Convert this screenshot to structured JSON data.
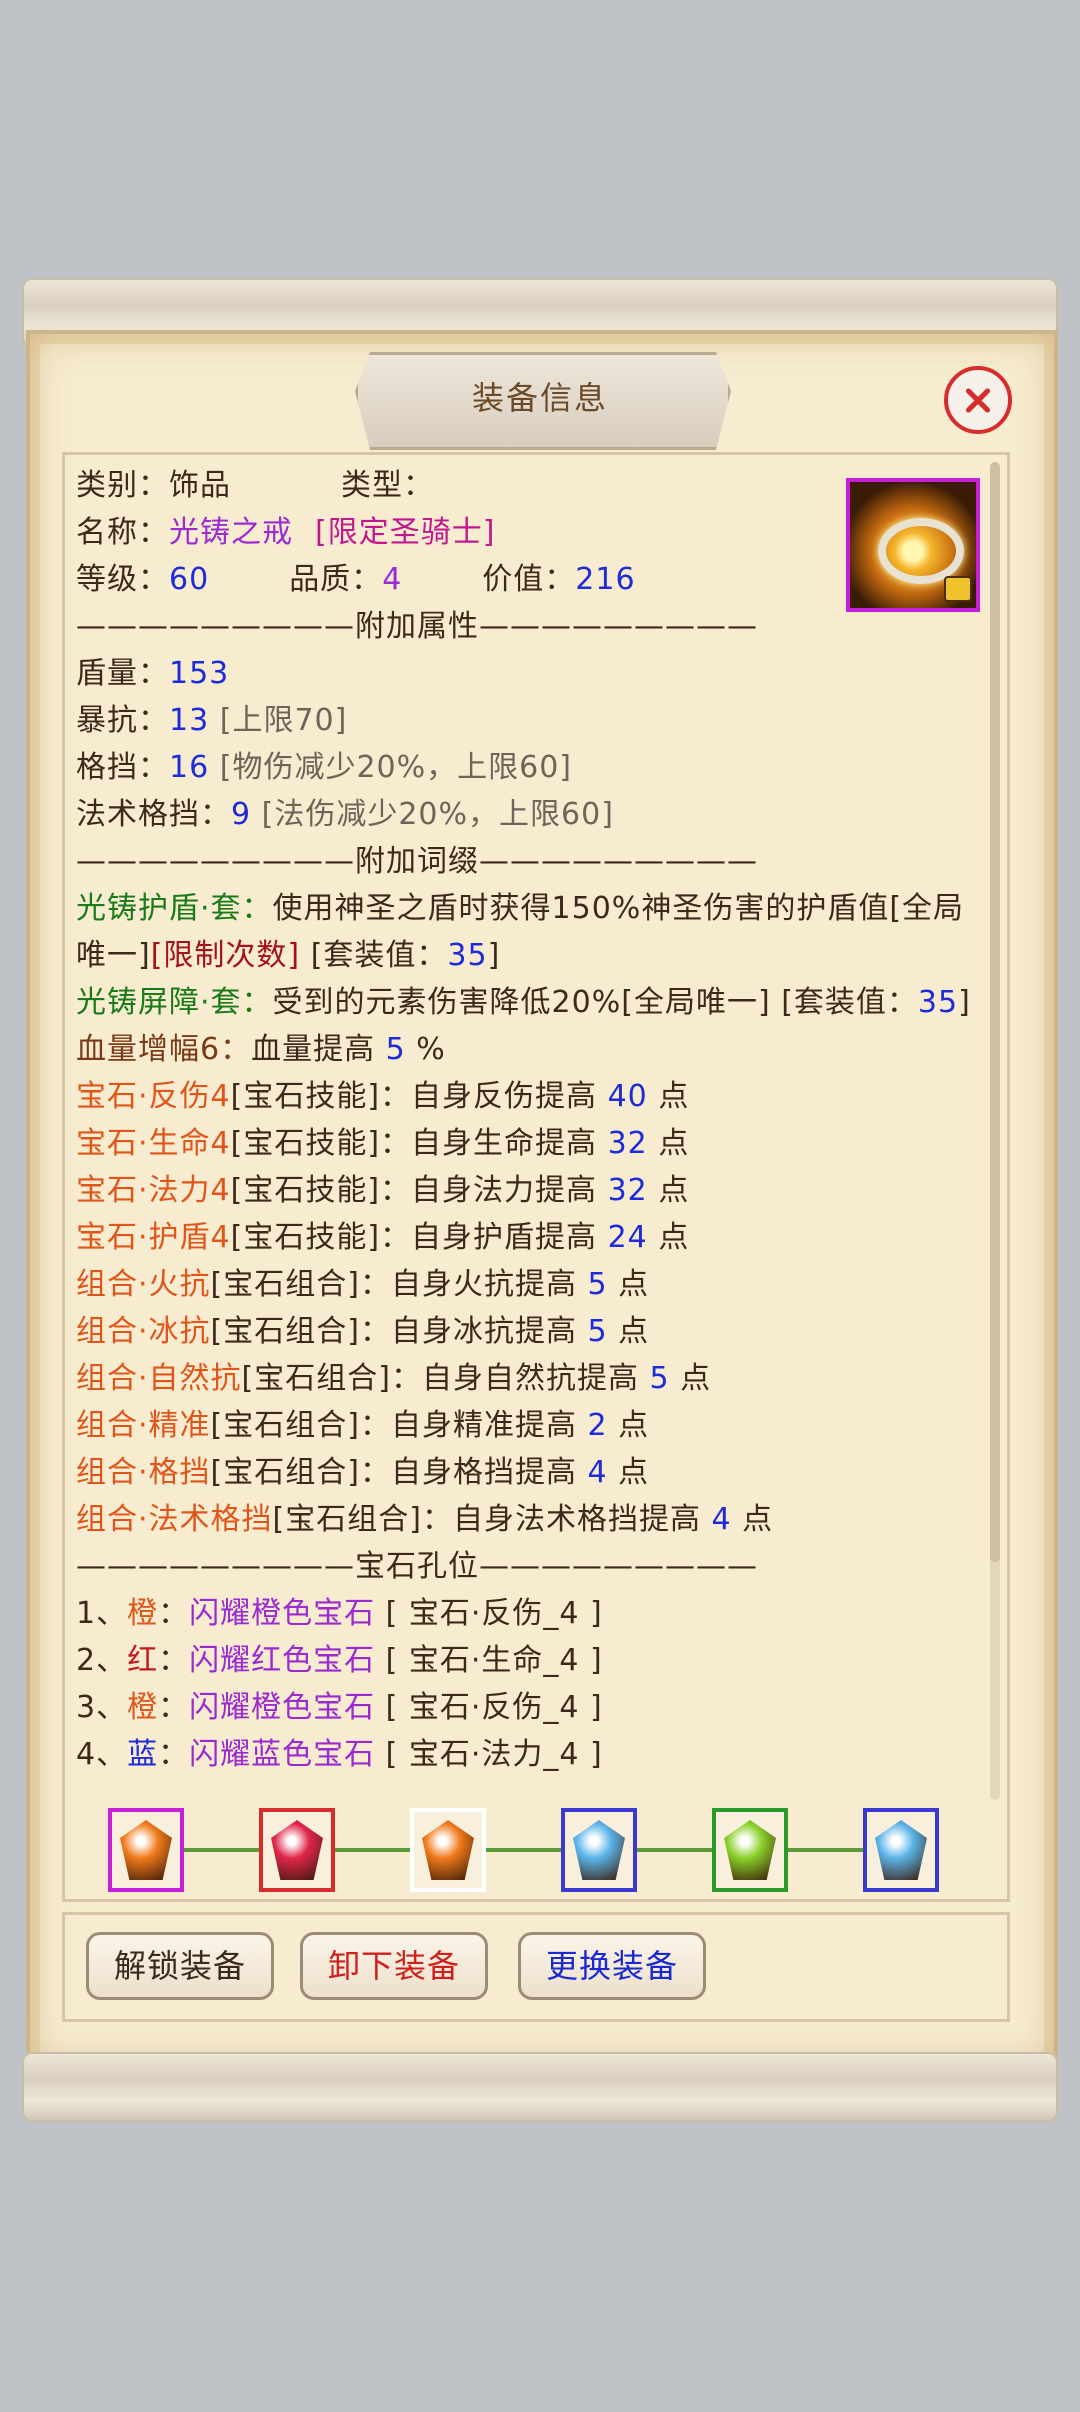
{
  "dialog": {
    "title": "装备信息"
  },
  "basic": {
    "category_label": "类别：",
    "category_value": "饰品",
    "type_label": "类型：",
    "type_value": "",
    "name_label": "名称：",
    "name_value": "光铸之戒",
    "name_tag": "[限定圣骑士]",
    "level_label": "等级：",
    "level_value": "60",
    "quality_label": "品质：",
    "quality_value": "4",
    "price_label": "价值：",
    "price_value": "216"
  },
  "section_attrs": "—————————附加属性—————————",
  "attrs": [
    {
      "label": "盾量：",
      "value": "153",
      "note": ""
    },
    {
      "label": "暴抗：",
      "value": "13",
      "note": "[上限70]"
    },
    {
      "label": "格挡：",
      "value": "16",
      "note": "[物伤减少20%，上限60]"
    },
    {
      "label": "法术格挡：",
      "value": "9",
      "note": "[法伤减少20%，上限60]"
    }
  ],
  "section_affix": "—————————附加词缀—————————",
  "affix": {
    "set1_name": "光铸护盾·套：",
    "set1_desc": "使用神圣之盾时获得150%神圣伤害的护盾值",
    "set1_unique": "[全局唯一]",
    "set1_limit": "[限制次数]",
    "set1_setlabel": "[套装值：",
    "set1_setvalue": "35",
    "set1_close": "]",
    "set2_name": "光铸屏障·套：",
    "set2_desc": "受到的元素伤害降低20%",
    "set2_unique": "[全局唯一]",
    "set2_setlabel": "[套装值：",
    "set2_setvalue": "35",
    "set2_close": "]",
    "hp_name": "血量增幅6：",
    "hp_desc": "血量提高",
    "hp_value": "5",
    "hp_unit": "%"
  },
  "gem_skills": [
    {
      "name": "宝石·反伤4",
      "tag": "[宝石技能]：",
      "desc": "自身反伤提高",
      "value": "40",
      "unit": "点"
    },
    {
      "name": "宝石·生命4",
      "tag": "[宝石技能]：",
      "desc": "自身生命提高",
      "value": "32",
      "unit": "点"
    },
    {
      "name": "宝石·法力4",
      "tag": "[宝石技能]：",
      "desc": "自身法力提高",
      "value": "32",
      "unit": "点"
    },
    {
      "name": "宝石·护盾4",
      "tag": "[宝石技能]：",
      "desc": "自身护盾提高",
      "value": "24",
      "unit": "点"
    }
  ],
  "combos": [
    {
      "name": "组合·火抗",
      "tag": "[宝石组合]：",
      "desc": "自身火抗提高",
      "value": "5",
      "unit": "点"
    },
    {
      "name": "组合·冰抗",
      "tag": "[宝石组合]：",
      "desc": "自身冰抗提高",
      "value": "5",
      "unit": "点"
    },
    {
      "name": "组合·自然抗",
      "tag": "[宝石组合]：",
      "desc": "自身自然抗提高",
      "value": "5",
      "unit": "点"
    },
    {
      "name": "组合·精准",
      "tag": "[宝石组合]：",
      "desc": "自身精准提高",
      "value": "2",
      "unit": "点"
    },
    {
      "name": "组合·格挡",
      "tag": "[宝石组合]：",
      "desc": "自身格挡提高",
      "value": "4",
      "unit": "点"
    },
    {
      "name": "组合·法术格挡",
      "tag": "[宝石组合]：",
      "desc": "自身法术格挡提高",
      "value": "4",
      "unit": "点"
    }
  ],
  "section_sockets": "—————————宝石孔位—————————",
  "sockets": [
    {
      "index": "1、",
      "color": "橙",
      "sep": "：",
      "gem": "闪耀橙色宝石",
      "skill": "[ 宝石·反伤_4 ]",
      "color_hex": "#e0561a"
    },
    {
      "index": "2、",
      "color": "红",
      "sep": "：",
      "gem": "闪耀红色宝石",
      "skill": "[ 宝石·生命_4 ]",
      "color_hex": "#c4161e"
    },
    {
      "index": "3、",
      "color": "橙",
      "sep": "：",
      "gem": "闪耀橙色宝石",
      "skill": "[ 宝石·反伤_4 ]",
      "color_hex": "#e0561a"
    },
    {
      "index": "4、",
      "color": "蓝",
      "sep": "：",
      "gem": "闪耀蓝色宝石",
      "skill": "[ 宝石·法力_4 ]",
      "color_hex": "#1e2bd8"
    }
  ],
  "gem_bar": [
    {
      "name": "orange-gem-icon",
      "frame": "#c71fd8",
      "fill": "#f07a1a"
    },
    {
      "name": "red-gem-icon",
      "frame": "#d62c2c",
      "fill": "#e0264a"
    },
    {
      "name": "orange-gem-icon",
      "frame": "#ffffff",
      "fill": "#f07a1a"
    },
    {
      "name": "blue-gem-icon",
      "frame": "#3a3ad0",
      "fill": "#5ab4e8"
    },
    {
      "name": "green-gem-icon",
      "frame": "#2a9a2a",
      "fill": "#8ad02a"
    },
    {
      "name": "blue-gem-icon",
      "frame": "#3a3ad0",
      "fill": "#5ab4e8"
    }
  ],
  "buttons": {
    "unlock": "解锁装备",
    "unequip": "卸下装备",
    "replace": "更换装备"
  },
  "colors": {
    "accent_blue": "#1e2bd8",
    "purple": "#9b2ad0",
    "orange": "#e0561a",
    "green": "#1a7a1a",
    "red": "#c4161e"
  }
}
